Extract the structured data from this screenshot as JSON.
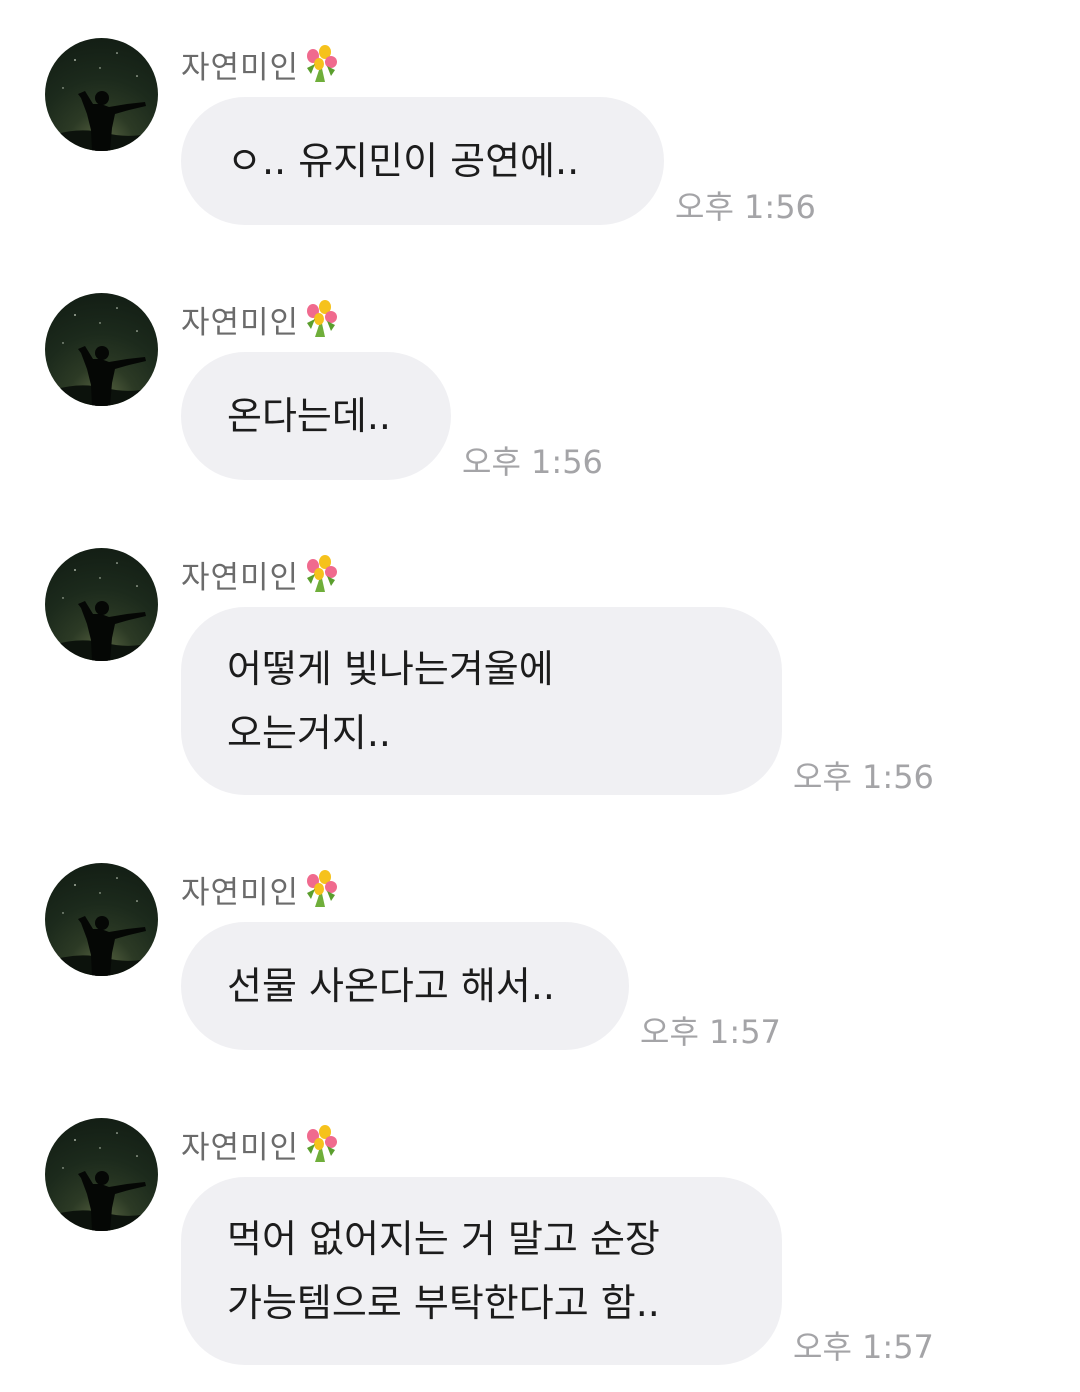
{
  "messages": [
    {
      "sender": "자연미인",
      "sender_emoji": "bouquet-icon",
      "text": "ㅇ.. 유지민이 공연에..",
      "time": "오후 1:56"
    },
    {
      "sender": "자연미인",
      "sender_emoji": "bouquet-icon",
      "text": "온다는데..",
      "time": "오후 1:56"
    },
    {
      "sender": "자연미인",
      "sender_emoji": "bouquet-icon",
      "text": "어떻게 빛나는겨울에\n오는거지..",
      "time": "오후 1:56"
    },
    {
      "sender": "자연미인",
      "sender_emoji": "bouquet-icon",
      "text": "선물 사온다고 해서..",
      "time": "오후 1:57"
    },
    {
      "sender": "자연미인",
      "sender_emoji": "bouquet-icon",
      "text": "먹어 없어지는 거 말고 순장\n가능템으로 부탁한다고 함..",
      "time": "오후 1:57"
    }
  ],
  "colors": {
    "bubble": "#f0f0f3",
    "message_text": "#1c1c1c",
    "sender_text": "#6b6b6b",
    "time_text": "#a4a4a7"
  }
}
